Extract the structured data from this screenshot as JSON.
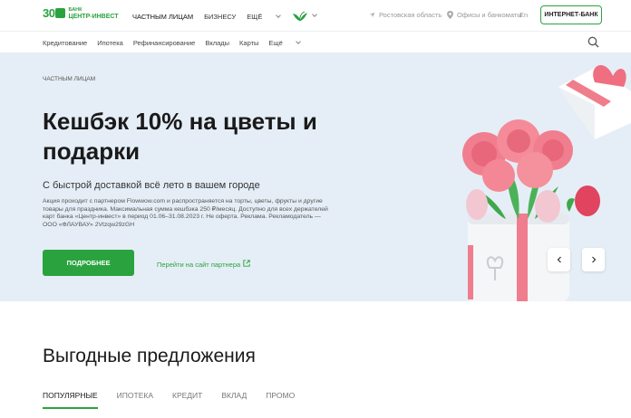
{
  "header": {
    "logo": {
      "num": "30",
      "line1": "БАНК",
      "line2": "ЦЕНТР-ИНВЕСТ"
    },
    "nav": [
      "ЧАСТНЫМ ЛИЦАМ",
      "БИЗНЕСУ",
      "ЕЩЁ"
    ],
    "region": "Ростовская область",
    "offices": "Офисы и банкоматы",
    "lang": "En",
    "internet_bank": "ИНТЕРНЕТ-БАНК"
  },
  "subnav": [
    "Кредитование",
    "Ипотека",
    "Рефинансирование",
    "Вклады",
    "Карты",
    "Ещё"
  ],
  "hero": {
    "crumb": "ЧАСТНЫМ ЛИЦАМ",
    "title": "Кешбэк 10% на цветы и подарки",
    "lead": "С быстрой доставкой всё лето в вашем городе",
    "fine": "Акция проходит с партнером Flowwow.com и распространяется на торты, цветы, фрукты и другие товары для праздника. Максимальная сумма кешбэка 250 ₽/месяц. Доступно для всех держателей карт банка «Центр-инвест» в период 01.06–31.08.2023 г. Не оферта. Реклама. Рекламодатель — ООО «ФЛАУВАУ» 2Vtzqw29zGH",
    "btn_more": "ПОДРОБНЕЕ",
    "partner_link": "Перейти на сайт партнера"
  },
  "offers": {
    "title": "Выгодные предложения",
    "tabs": [
      "ПОПУЛЯРНЫЕ",
      "ИПОТЕКА",
      "КРЕДИТ",
      "ВКЛАД",
      "ПРОМО"
    ]
  },
  "colors": {
    "brand": "#2aa33f",
    "hero_bg": "#e5eef6"
  }
}
